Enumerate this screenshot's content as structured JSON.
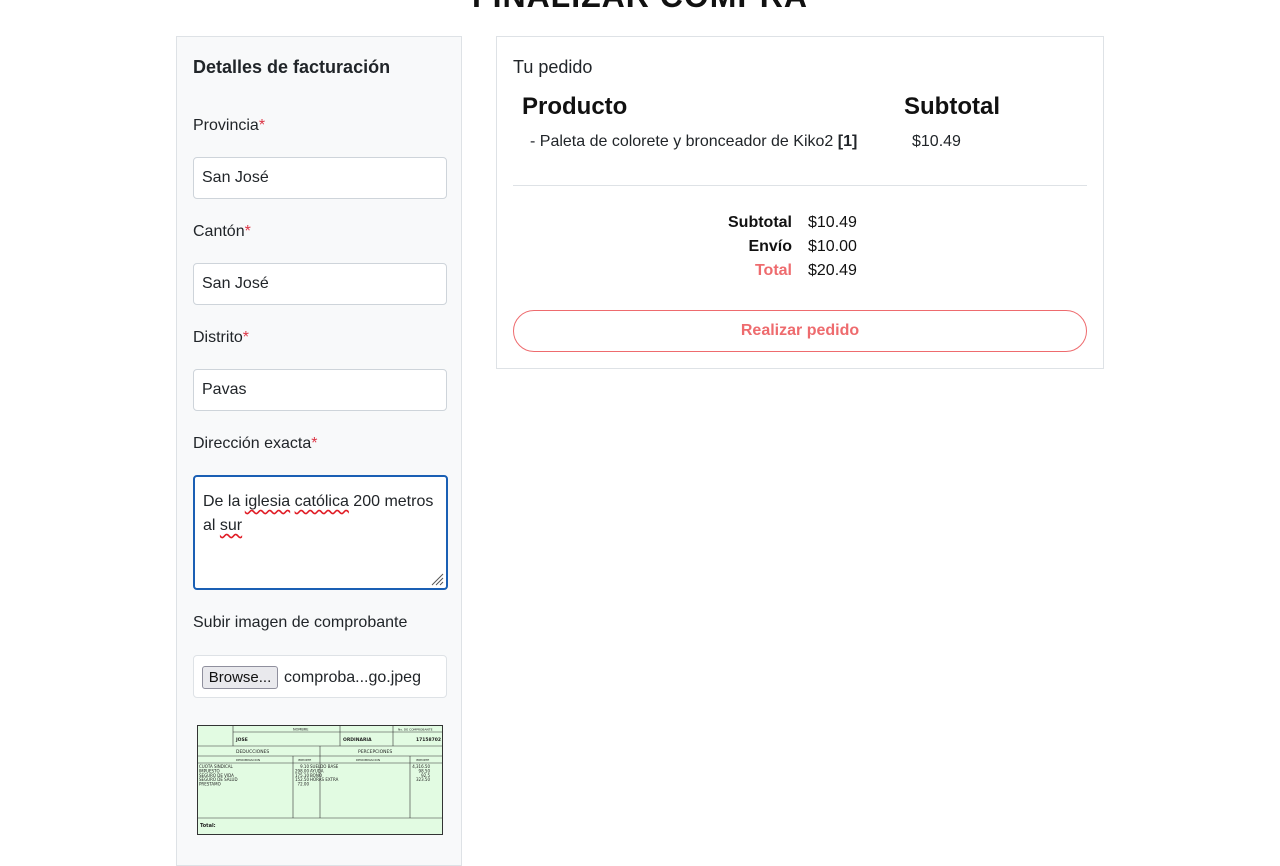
{
  "page": {
    "title": "FINALIZAR COMPRA"
  },
  "billing": {
    "heading": "Detalles de facturación",
    "required_mark": "*",
    "provincia": {
      "label": "Provincia",
      "value": "San José"
    },
    "canton": {
      "label": "Cantón",
      "value": "San José"
    },
    "distrito": {
      "label": "Distrito",
      "value": "Pavas"
    },
    "direccion": {
      "label": "Dirección exacta",
      "value_parts": [
        "De la ",
        "iglesia",
        " ",
        "católica",
        " 200 metros al ",
        "sur"
      ]
    },
    "comprobante": {
      "label": "Subir imagen de comprobante",
      "browse_label": "Browse...",
      "file_name": "comproba...go.jpeg"
    }
  },
  "receipt": {
    "name_header": "NOMBRE",
    "cedula_header": "No. DE COMPROBANTE",
    "name": "JOSE",
    "tipo": "ORDINARIA",
    "numero": "17158702",
    "deducciones": "DEDUCCIONES",
    "percepciones": "PERCEPCIONES",
    "denominacion": "DENOMINACION",
    "importe": "IMPORTE",
    "ded_items": "CUOTA SINDICAL\nIMPUESTO\nSEGURO DE VIDA\nSEGURO DE SALUD\nPRESTAMO",
    "ded_values": "9.10\n298.00\n175.10\n152.50\n72.00",
    "per_items": "SUELDO BASE\nAYUDA\nBONO\nHORAS EXTRA",
    "per_values": "4,316.50\n98.50\n92.5\n323.50",
    "total_label": "Total:"
  },
  "order": {
    "heading": "Tu pedido",
    "col_product": "Producto",
    "col_subtotal": "Subtotal",
    "items": [
      {
        "name": "- Paleta de colorete y bronceador de Kiko2",
        "qty": "[1]",
        "subtotal": "$10.49"
      }
    ],
    "summary": {
      "subtotal_label": "Subtotal",
      "subtotal_value": "$10.49",
      "shipping_label": "Envío",
      "shipping_value": "$10.00",
      "total_label": "Total",
      "total_value": "$20.49"
    },
    "cta_label": "Realizar pedido"
  },
  "colors": {
    "accent": "#ee6b6e",
    "required": "#dc3545",
    "focus": "#1a5fb4"
  }
}
